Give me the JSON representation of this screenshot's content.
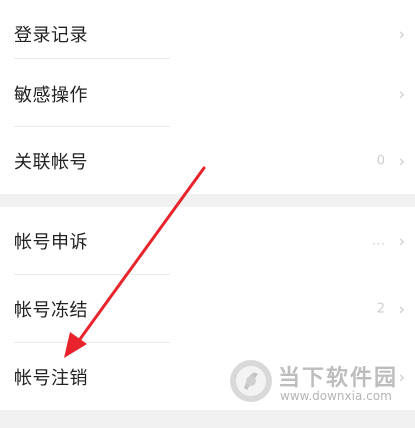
{
  "colors": {
    "page_bg": "#f1f1f1",
    "item_bg": "#ffffff",
    "text": "#222222",
    "chevron": "#c8c8c8",
    "annotation_arrow": "#e8232b",
    "watermark": "#bdbdbd"
  },
  "groups": [
    {
      "items": [
        {
          "label": "登录记录",
          "value": "",
          "icon": "chevron-right-icon"
        },
        {
          "label": "敏感操作",
          "value": "",
          "icon": "chevron-right-icon"
        },
        {
          "label": "关联帐号",
          "value": "0",
          "icon": "chevron-right-icon"
        }
      ]
    },
    {
      "items": [
        {
          "label": "帐号申诉",
          "value": "…",
          "icon": "chevron-right-icon"
        },
        {
          "label": "帐号冻结",
          "value": "2",
          "icon": "chevron-right-icon"
        },
        {
          "label": "帐号注销",
          "value": "",
          "icon": "chevron-right-icon"
        }
      ]
    }
  ],
  "chevron_glyph": "›",
  "watermark": {
    "title": "当下软件园",
    "url": "www.downxia.com"
  }
}
